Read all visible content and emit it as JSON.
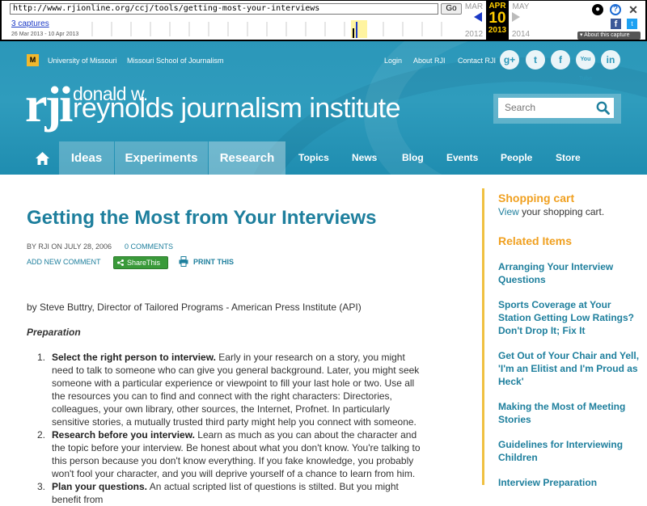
{
  "wayback": {
    "url": "http://www.rjionline.org/ccj/tools/getting-most-your-interviews",
    "go_label": "Go",
    "captures": "3 captures",
    "date_range": "26 Mar 2013 - 10 Apr 2013",
    "prev_month": "MAR",
    "current_month": "APR",
    "next_month": "MAY",
    "current_day": "10",
    "prev_year": "2012",
    "current_year": "2013",
    "next_year": "2014",
    "about_label": "About this capture",
    "help_icon": "?",
    "close_icon": "✕",
    "facebook_icon": "f",
    "twitter_icon": "t"
  },
  "header": {
    "university_link": "University of Missouri",
    "school_link": "Missouri School of Journalism",
    "login": "Login",
    "about": "About RJI",
    "contact": "Contact RJI",
    "mu_logo": "M",
    "logo_rji": "rji",
    "logo_donald": "donald w.",
    "logo_name": "reynolds journalism institute",
    "social": {
      "google": "g+",
      "twitter": "t",
      "facebook": "f",
      "youtube": "You Tube",
      "linkedin": "in"
    },
    "search_placeholder": "Search"
  },
  "nav": {
    "ideas": "Ideas",
    "experiments": "Experiments",
    "research": "Research",
    "topics": "Topics",
    "news": "News",
    "blog": "Blog",
    "events": "Events",
    "people": "People",
    "store": "Store"
  },
  "article": {
    "title": "Getting the Most from Your Interviews",
    "byline": "By RJI on July 28, 2006",
    "comments": "0 COMMENTS",
    "add_comment": "ADD NEW COMMENT",
    "share": "ShareThis",
    "print": "PRINT THIS",
    "author": "by Steve Buttry, Director of Tailored Programs - American Press Institute (API)",
    "section": "Preparation",
    "steps": [
      {
        "num": "1.",
        "lead": "Select the right person to interview.",
        "text": " Early in your research on a story, you might need to talk to someone who can give you general background. Later, you might seek someone with a particular experience or viewpoint to fill your last hole or two. Use all the resources you can to find and connect with the right characters: Directories, colleagues, your own library, other sources, the Internet, Profnet. In particularly sensitive stories, a mutually trusted third party might help you connect with someone."
      },
      {
        "num": "2.",
        "lead": "Research before you interview.",
        "text": " Learn as much as you can about the character and the topic before your interview. Be honest about what you don't know. You're talking to this person because you don't know everything. If you fake knowledge, you probably won't fool your character, and you will deprive yourself of a chance to learn from him."
      },
      {
        "num": "3.",
        "lead": "Plan your questions.",
        "text": " An actual scripted list of questions is stilted. But you might benefit from"
      }
    ]
  },
  "sidebar": {
    "cart_heading": "Shopping cart",
    "cart_link": "View",
    "cart_text": " your shopping cart.",
    "related_heading": "Related Items",
    "related": [
      "Arranging Your Interview Questions",
      "Sports Coverage at Your Station Getting Low Ratings? Don't Drop It; Fix It",
      "Get Out of Your Chair and Yell, 'I'm an Elitist and I'm Proud as Heck'",
      "Making the Most of Meeting Stories",
      "Guidelines for Interviewing Children",
      "Interview Preparation"
    ]
  },
  "colors": {
    "brand": "#2b97b9",
    "title": "#1e7f9d",
    "accent": "#f0a020"
  }
}
